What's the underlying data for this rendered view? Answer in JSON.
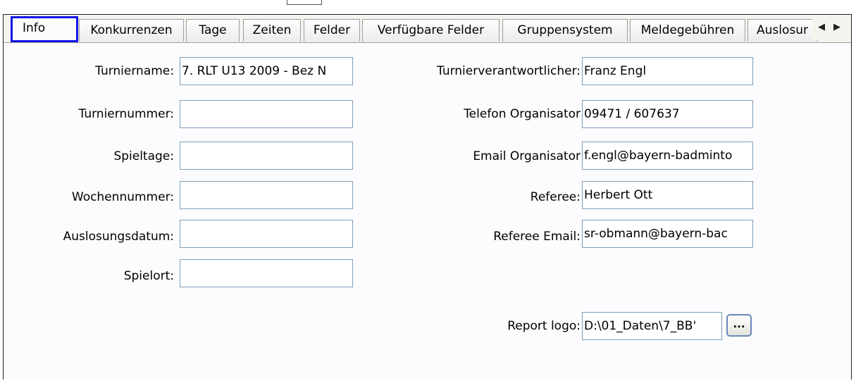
{
  "tabs": [
    {
      "label": "Info",
      "active": true
    },
    {
      "label": "Konkurrenzen"
    },
    {
      "label": "Tage"
    },
    {
      "label": "Zeiten"
    },
    {
      "label": "Felder"
    },
    {
      "label": "Verfügbare Felder"
    },
    {
      "label": "Gruppensystem"
    },
    {
      "label": "Meldegebühren"
    },
    {
      "label": "Auslosur"
    }
  ],
  "left_fields": {
    "turniername": {
      "label": "Turniername:",
      "value": "7. RLT U13 2009 - Bez N"
    },
    "turniernummer": {
      "label": "Turniernummer:",
      "value": ""
    },
    "spieltage": {
      "label": "Spieltage:",
      "value": ""
    },
    "wochennummer": {
      "label": "Wochennummer:",
      "value": ""
    },
    "auslosungsdatum": {
      "label": "Auslosungsdatum:",
      "value": ""
    },
    "spielort": {
      "label": "Spielort:",
      "value": ""
    }
  },
  "right_fields": {
    "turnierverantwortlicher": {
      "label": "Turnierverantwortlicher:",
      "value": "Franz Engl"
    },
    "telefon": {
      "label": "Telefon Organisator",
      "value": "09471 / 607637"
    },
    "email": {
      "label": "Email Organisator",
      "value": "f.engl@bayern-badminto"
    },
    "referee": {
      "label": "Referee:",
      "value": "Herbert Ott"
    },
    "referee_email": {
      "label": "Referee Email:",
      "value": "sr-obmann@bayern-bac"
    },
    "report_logo": {
      "label": "Report logo:",
      "value": "D:\\01_Daten\\7_BB'",
      "browse_label": "..."
    }
  },
  "colors": {
    "active_tab_border": "#1414e6",
    "field_border": "#7f9db9"
  }
}
